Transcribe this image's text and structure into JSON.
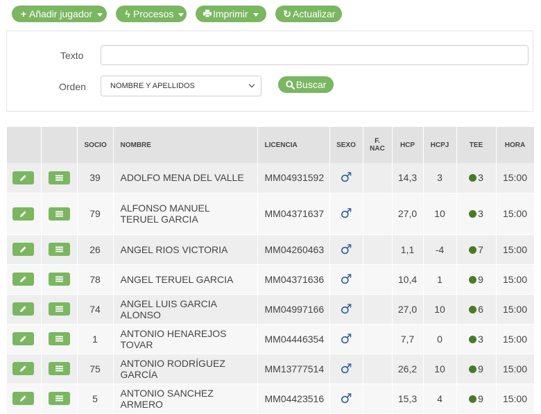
{
  "toolbar": {
    "add_player": "Añadir jugador",
    "processes": "Procesos",
    "print": "Imprimir",
    "refresh": "Actualizar"
  },
  "filter": {
    "text_label": "Texto",
    "text_value": "",
    "order_label": "Orden",
    "order_selected": "NOMBRE Y APELLIDOS",
    "search_button": "Buscar"
  },
  "table": {
    "headers": {
      "edit": "",
      "list": "",
      "socio": "SOCIO",
      "nombre": "NOMBRE",
      "licencia": "LICENCIA",
      "sexo": "SEXO",
      "fnac_line1": "F.",
      "fnac_line2": "NAC",
      "hcp": "HCP",
      "hcpj": "HCPJ",
      "tee": "TEE",
      "hora": "HORA"
    },
    "sex_symbol": "♂",
    "rows": [
      {
        "socio": "39",
        "nombre": "ADOLFO MENA DEL VALLE",
        "licencia": "MM04931592",
        "fnac": "",
        "hcp": "14,3",
        "hcpj": "3",
        "tee": "3",
        "hora": "15:00"
      },
      {
        "socio": "79",
        "nombre": "ALFONSO MANUEL TERUEL GARCIA",
        "licencia": "MM04371637",
        "fnac": "",
        "hcp": "27,0",
        "hcpj": "10",
        "tee": "3",
        "hora": "15:00"
      },
      {
        "socio": "26",
        "nombre": "ANGEL RIOS VICTORIA",
        "licencia": "MM04260463",
        "fnac": "",
        "hcp": "1,1",
        "hcpj": "-4",
        "tee": "7",
        "hora": "15:00"
      },
      {
        "socio": "78",
        "nombre": "ANGEL TERUEL GARCIA",
        "licencia": "MM04371636",
        "fnac": "",
        "hcp": "10,4",
        "hcpj": "1",
        "tee": "9",
        "hora": "15:00"
      },
      {
        "socio": "74",
        "nombre": "ANGEL LUIS GARCIA ALONSO",
        "licencia": "MM04997166",
        "fnac": "",
        "hcp": "27,0",
        "hcpj": "10",
        "tee": "6",
        "hora": "15:00"
      },
      {
        "socio": "1",
        "nombre": "ANTONIO HENAREJOS TOVAR",
        "licencia": "MM04446354",
        "fnac": "",
        "hcp": "7,7",
        "hcpj": "0",
        "tee": "3",
        "hora": "15:00"
      },
      {
        "socio": "75",
        "nombre": "ANTONIO RODRÍGUEZ GARCÍA",
        "licencia": "MM13777514",
        "fnac": "",
        "hcp": "26,2",
        "hcpj": "10",
        "tee": "9",
        "hora": "15:00"
      },
      {
        "socio": "5",
        "nombre": "ANTONIO SANCHEZ ARMERO",
        "licencia": "MM04423516",
        "fnac": "",
        "hcp": "15,3",
        "hcpj": "4",
        "tee": "9",
        "hora": "15:00"
      }
    ]
  },
  "colors": {
    "accent": "#7bb661",
    "tee_dot": "#4a7a27",
    "male_symbol": "#2e5e9e"
  },
  "icons": {
    "add_player": "plus-icon",
    "processes": "bolt-icon",
    "print": "print-icon",
    "refresh": "refresh-icon",
    "search": "search-icon",
    "edit": "pencil-icon",
    "list": "list-icon",
    "sex": "male-icon",
    "tee": "dot-icon",
    "dropdown": "caret-down-icon"
  }
}
